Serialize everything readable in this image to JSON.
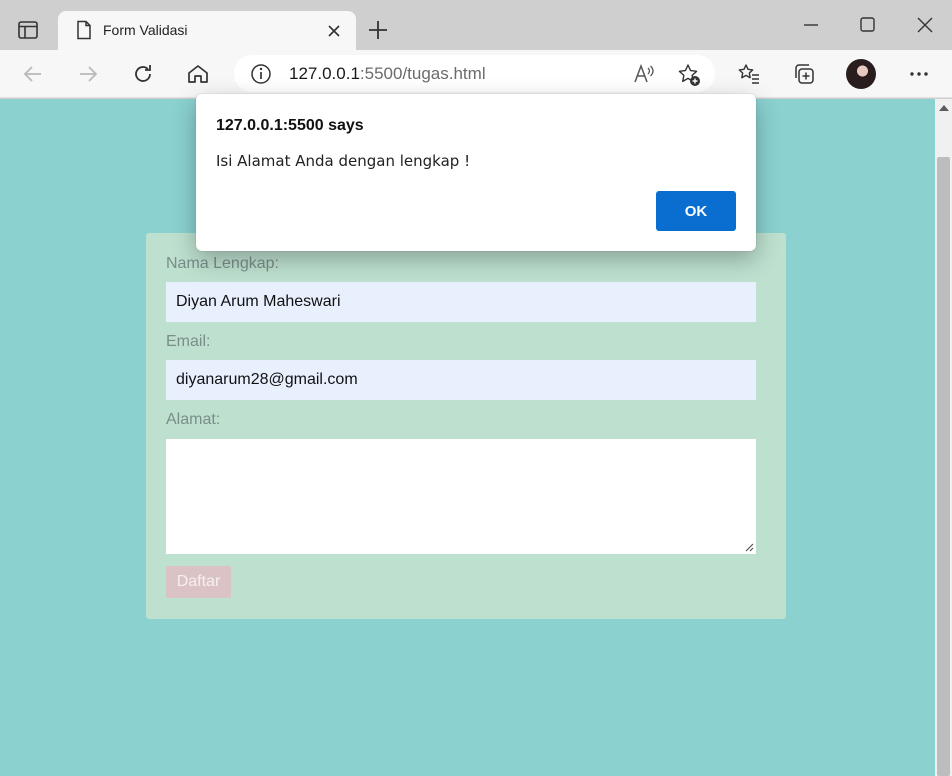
{
  "browser": {
    "tab_title": "Form Validasi",
    "url_host": "127.0.0.1",
    "url_rest": ":5500/tugas.html"
  },
  "form": {
    "name_label": "Nama Lengkap:",
    "name_value": "Diyan Arum Maheswari",
    "email_label": "Email:",
    "email_value": "diyanarum28@gmail.com",
    "address_label": "Alamat:",
    "address_value": "",
    "submit_label": "Daftar"
  },
  "alert": {
    "title": "127.0.0.1:5500 says",
    "message": "Isi Alamat Anda dengan lengkap !",
    "ok_label": "OK"
  },
  "colors": {
    "page_background": "#8ad1d0",
    "form_background": "#bde0cf",
    "ok_button": "#0a6ed1",
    "submit_button": "#dbc3c5"
  },
  "icons": [
    "tab-actions-icon",
    "document-icon",
    "close-icon",
    "plus-icon",
    "minimize-icon",
    "maximize-icon",
    "window-close-icon",
    "back-icon",
    "forward-icon",
    "refresh-icon",
    "home-icon",
    "info-icon",
    "read-aloud-icon",
    "add-favorite-icon",
    "favorites-icon",
    "collections-icon",
    "more-icon"
  ]
}
